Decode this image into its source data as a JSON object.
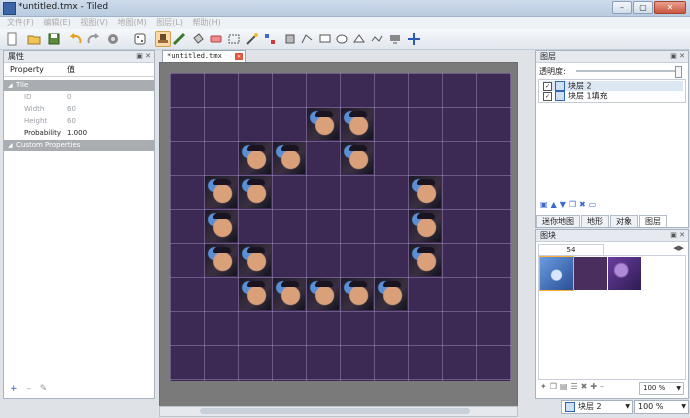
{
  "window": {
    "title": "*untitled.tmx - Tiled",
    "min": "–",
    "max": "▢",
    "close": "✕"
  },
  "menu": [
    "文件(F)",
    "编辑(E)",
    "视图(V)",
    "地图(M)",
    "图层(L)",
    "帮助(H)"
  ],
  "properties_panel": {
    "title": "属性",
    "header": {
      "property": "Property",
      "value": "值"
    },
    "tile_section": "Tile",
    "rows": [
      {
        "key": "ID",
        "value": "0"
      },
      {
        "key": "Width",
        "value": "60"
      },
      {
        "key": "Height",
        "value": "60"
      },
      {
        "key": "Probability",
        "value": "1.000"
      }
    ],
    "custom_section": "Custom Properties",
    "bottom_buttons": {
      "add": "+",
      "remove": "–",
      "edit": "✎"
    }
  },
  "document": {
    "tab": "*untitled.tmx",
    "close": "✕"
  },
  "layers_panel": {
    "title": "图层",
    "opacity_label": "透明度:",
    "opacity": 1.0,
    "layers": [
      {
        "name": "块层 2",
        "checked": "✓"
      },
      {
        "name": "块层 1填充",
        "checked": "✓"
      }
    ],
    "tabs": [
      "迷你地图",
      "地形",
      "对象",
      "图层"
    ]
  },
  "tiles_panel": {
    "title": "图块",
    "tileset": "54",
    "zoom": "100 %"
  },
  "statusbar": {
    "layer": "块层 2",
    "zoom": "100 %"
  },
  "colors": {
    "map_bg": "#3c2a55",
    "accent": "#f9d9a6"
  }
}
